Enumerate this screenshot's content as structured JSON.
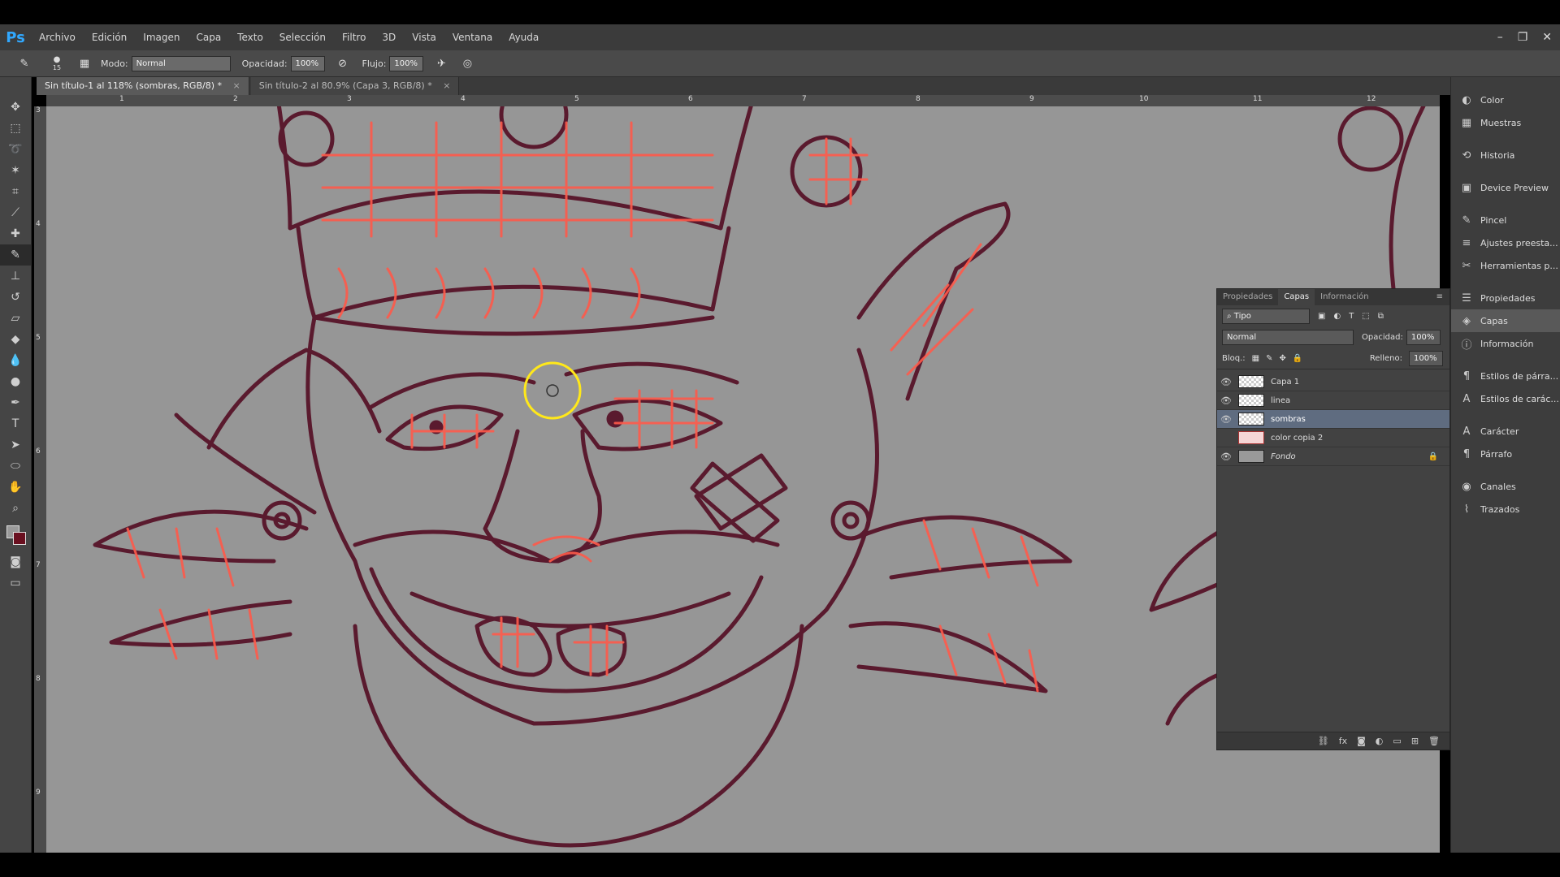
{
  "app": {
    "logo": "Ps"
  },
  "menu": [
    "Archivo",
    "Edición",
    "Imagen",
    "Capa",
    "Texto",
    "Selección",
    "Filtro",
    "3D",
    "Vista",
    "Ventana",
    "Ayuda"
  ],
  "window_controls": [
    "–",
    "❐",
    "✕"
  ],
  "options": {
    "brush_size": "15",
    "mode_label": "Modo:",
    "mode_value": "Normal",
    "opacity_label": "Opacidad:",
    "opacity_value": "100%",
    "flow_label": "Flujo:",
    "flow_value": "100%"
  },
  "tabs": [
    {
      "label": "Sin título-1 al 118% (sombras, RGB/8) *",
      "close": "×"
    },
    {
      "label": "Sin título-2 al 80.9% (Capa 3, RGB/8) *",
      "close": "×"
    }
  ],
  "ruler_h": [
    "1",
    "2",
    "3",
    "4",
    "5",
    "6",
    "7",
    "8",
    "9",
    "10",
    "11",
    "12"
  ],
  "ruler_v": [
    "3",
    "4",
    "5",
    "6",
    "7",
    "8",
    "9"
  ],
  "dock": {
    "group1": [
      "Color",
      "Muestras"
    ],
    "group2": [
      "Historia"
    ],
    "group3": [
      "Device Preview"
    ],
    "group4": [
      "Pincel",
      "Ajustes preesta...",
      "Herramientas p..."
    ],
    "group5": [
      "Propiedades",
      "Capas",
      "Información"
    ],
    "group6": [
      "Estilos de párra...",
      "Estilos de carác..."
    ],
    "group7": [
      "Carácter",
      "Párrafo"
    ],
    "group8": [
      "Canales",
      "Trazados"
    ]
  },
  "layers_panel": {
    "tabs": [
      "Propiedades",
      "Capas",
      "Información"
    ],
    "filter": "Tipo",
    "blend_mode": "Normal",
    "opacity_label": "Opacidad:",
    "opacity_value": "100%",
    "lock_label": "Bloq.:",
    "fill_label": "Relleno:",
    "fill_value": "100%",
    "layers": [
      {
        "name": "Capa 1"
      },
      {
        "name": "linea"
      },
      {
        "name": "sombras"
      },
      {
        "name": "color copia 2"
      },
      {
        "name": "Fondo"
      }
    ]
  },
  "colors": {
    "accent_blue": "#31a8ff",
    "canvas_gray": "#969696",
    "line_color": "#5a1a2e",
    "sketch_red": "#ff5a4a",
    "cursor_yellow": "#ffe81a"
  }
}
